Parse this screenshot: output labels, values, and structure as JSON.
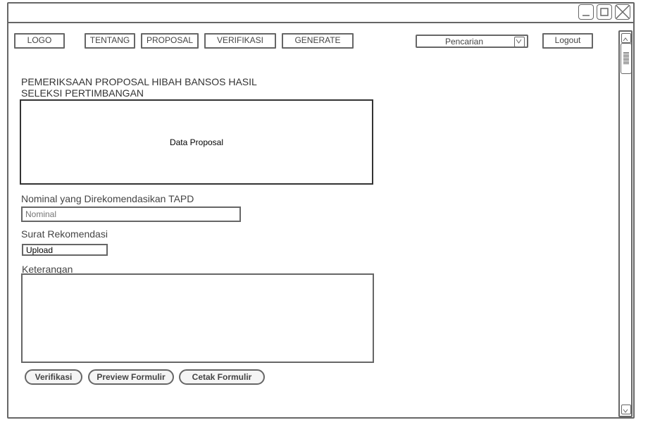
{
  "window": {
    "controls": [
      "minimize-icon",
      "maximize-icon",
      "close-icon"
    ]
  },
  "nav": {
    "logo": "LOGO",
    "tentang": "TENTANG",
    "proposal": "PROPOSAL",
    "verifikasi": "VERIFIKASI",
    "generate": "GENERATE",
    "search_label": "Pencarian",
    "logout": "Logout"
  },
  "main": {
    "title_line1": "PEMERIKSAAN PROPOSAL HIBAH BANSOS HASIL",
    "title_line2": "SELEKSI PERTIMBANGAN",
    "data_box_label": "Data Proposal",
    "nominal_label": "Nominal yang Direkomendasikan TAPD",
    "nominal_placeholder": "Nominal",
    "surat_label": "Surat Rekomendasi",
    "upload_label": "Upload",
    "keterangan_label": "Keterangan"
  },
  "actions": {
    "verifikasi": "Verifikasi",
    "preview": "Preview Formulir",
    "cetak": "Cetak Formulir"
  }
}
